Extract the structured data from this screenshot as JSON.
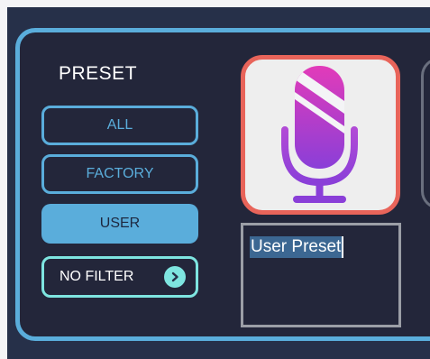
{
  "preset": {
    "title": "PRESET",
    "filters": [
      {
        "label": "ALL",
        "active": false
      },
      {
        "label": "FACTORY",
        "active": false
      },
      {
        "label": "USER",
        "active": true
      }
    ],
    "no_filter_label": "NO FILTER"
  },
  "preset_name": {
    "value": "User Preset"
  },
  "icons": {
    "preset_icon": "microphone-icon",
    "chevron": "chevron-right-icon"
  },
  "colors": {
    "accent": "#5aaddb",
    "teal": "#7ee5e0",
    "tile_border": "#e8645a",
    "mic_gradient_top": "#e23bb9",
    "mic_gradient_bottom": "#8a3fd8",
    "background": "#23263a"
  }
}
